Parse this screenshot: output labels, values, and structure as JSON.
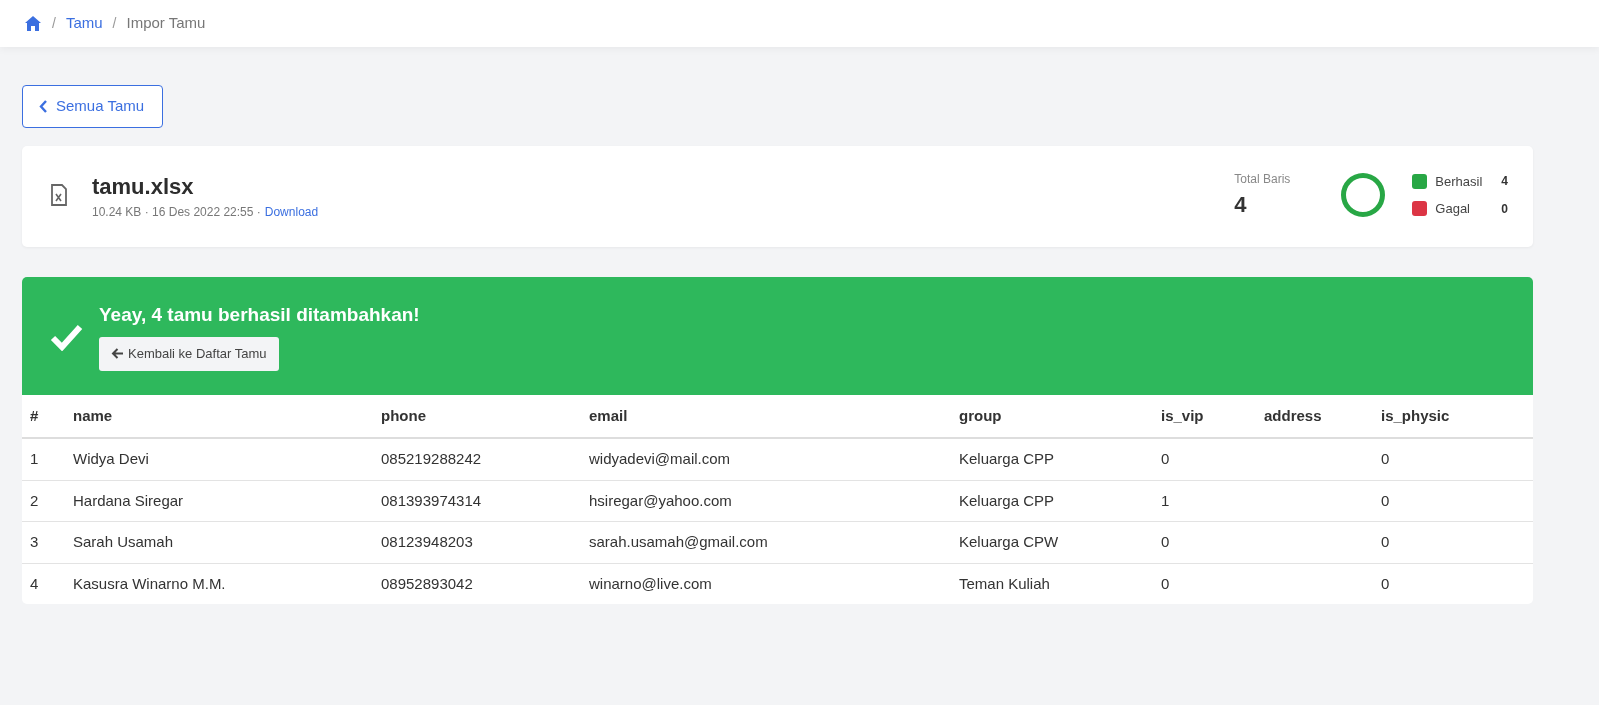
{
  "breadcrumb": {
    "separator": "/",
    "items": [
      {
        "label": "Tamu",
        "kind": "link"
      },
      {
        "label": "Impor Tamu",
        "kind": "current"
      }
    ]
  },
  "back_button": {
    "label": "Semua Tamu"
  },
  "file": {
    "name": "tamu.xlsx",
    "meta": "10.24 KB · 16 Des 2022 22:55 ·",
    "link": "Download"
  },
  "summary": {
    "label": "Total Baris",
    "value": "4",
    "legend": [
      {
        "label": "Berhasil",
        "count": "4",
        "color": "#28a745"
      },
      {
        "label": "Gagal",
        "count": "0",
        "color": "#dc3545"
      }
    ]
  },
  "alert": {
    "message": "Yeay, 4 tamu berhasil ditambahkan!",
    "button": "Kembali ke Daftar Tamu"
  },
  "table": {
    "columns": [
      "#",
      "name",
      "phone",
      "email",
      "group",
      "is_vip",
      "address",
      "is_physic"
    ],
    "rows": [
      [
        "1",
        "Widya Devi",
        "085219288242",
        "widyadevi@mail.com",
        "Keluarga CPP",
        "0",
        "",
        "0"
      ],
      [
        "2",
        "Hardana Siregar",
        "081393974314",
        "hsiregar@yahoo.com",
        "Keluarga CPP",
        "1",
        "",
        "0"
      ],
      [
        "3",
        "Sarah Usamah",
        "08123948203",
        "sarah.usamah@gmail.com",
        "Keluarga CPW",
        "0",
        "",
        "0"
      ],
      [
        "4",
        "Kasusra Winarno M.M.",
        "08952893042",
        "winarno@live.com",
        "Teman Kuliah",
        "0",
        "",
        "0"
      ]
    ]
  }
}
